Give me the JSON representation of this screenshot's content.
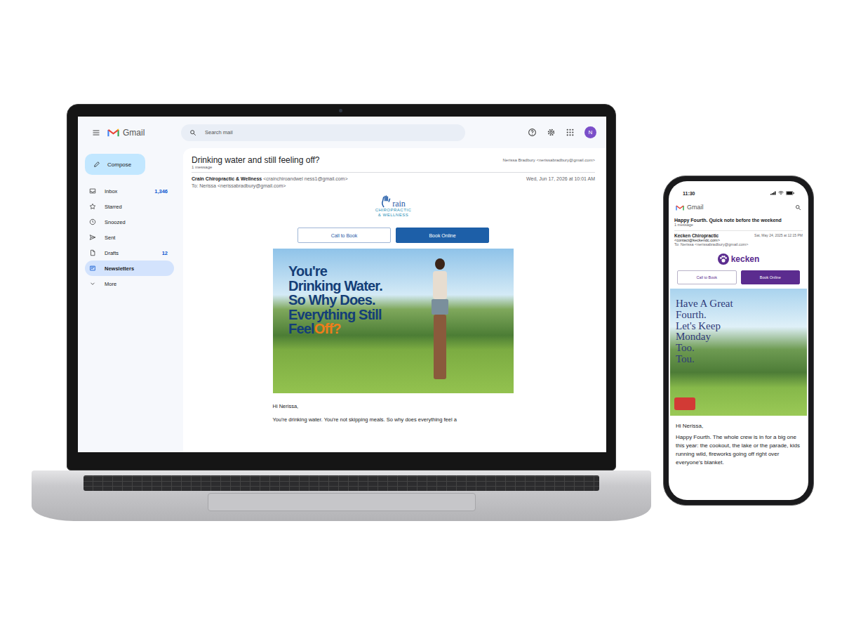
{
  "laptop": {
    "app": {
      "name": "Gmail",
      "search_placeholder": "Search mail",
      "avatar": "N"
    },
    "compose": "Compose",
    "sidebar": [
      {
        "label": "Inbox",
        "count": "1,346",
        "selected": false
      },
      {
        "label": "Starred",
        "count": "",
        "selected": false
      },
      {
        "label": "Snoozed",
        "count": "",
        "selected": false
      },
      {
        "label": "Sent",
        "count": "",
        "selected": false
      },
      {
        "label": "Drafts",
        "count": "12",
        "selected": false
      },
      {
        "label": "Newsletters",
        "count": "",
        "selected": true
      },
      {
        "label": "More",
        "count": "",
        "selected": false
      }
    ],
    "email": {
      "subject": "Drinking water and still feeling off?",
      "count": "1 message",
      "header_recipient": "Nerissa Bradbury <nerissabradbury@gmail.com>",
      "from_name": "Crain Chiropractic & Wellness",
      "from_address": "<crainchiroandwel ness1@gmail.com>",
      "date": "Wed, Jun 17, 2026 at 10:01 AM",
      "to": "To: Nerissa <nerissabradbury@gmail.com>",
      "logo": {
        "mark": "rain",
        "lines": [
          "CHIROPRACTIC",
          "& WELLNESS"
        ]
      },
      "buttons": [
        {
          "label": "Call to Book",
          "primary": false
        },
        {
          "label": "Book Online",
          "primary": true
        }
      ],
      "hero": {
        "lines": [
          {
            "text": "You're"
          },
          {
            "text": "Drinking Water."
          },
          {
            "text": "So Why Does."
          },
          {
            "text": "Everything Still"
          },
          {
            "text": "Feel",
            "accent": "Off?"
          }
        ]
      },
      "greeting": "Hi Nerissa,",
      "body": "You're drinking water. You're not skipping meals. So why does everything feel a"
    }
  },
  "phone": {
    "status_time": "11:30",
    "app": {
      "name": "Gmail"
    },
    "email": {
      "subject": "Happy Fourth. Quick note before the weekend",
      "count": "1 message",
      "from_name": "Kecken Chiropractic",
      "from_address": "<contact@keckendc.com>",
      "date": "Sat, May 24, 2025 at 12:15 PM",
      "to": "To: Nerissa <nerissabradbury@gmail.com>",
      "logo": {
        "mark": "kecken"
      },
      "buttons": [
        {
          "label": "Call to Book",
          "primary": false
        },
        {
          "label": "Book Online",
          "primary": true
        }
      ],
      "hero": {
        "lines": [
          "Have A Great",
          "Fourth.",
          "Let's Keep",
          "Monday",
          "Too.",
          "Tou."
        ]
      },
      "greeting": "Hi Nerissa,",
      "body": "Happy Fourth. The whole crew is in for a big one this year: the cookout, the lake or the parade, kids running wild, fireworks going off right over everyone's blanket."
    }
  }
}
